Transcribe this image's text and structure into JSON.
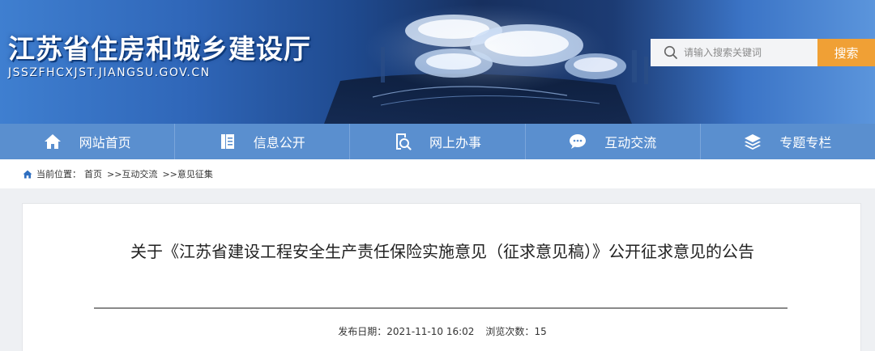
{
  "site": {
    "title": "江苏省住房和城乡建设厅",
    "domain": "JSSZFHCXJST.JIANGSU.GOV.CN"
  },
  "search": {
    "placeholder": "请输入搜索关键词",
    "button_label": "搜索"
  },
  "nav": {
    "items": [
      {
        "label": "网站首页",
        "icon": "home-icon"
      },
      {
        "label": "信息公开",
        "icon": "document-icon"
      },
      {
        "label": "网上办事",
        "icon": "search-document-icon"
      },
      {
        "label": "互动交流",
        "icon": "chat-bubble-icon"
      },
      {
        "label": "专题专栏",
        "icon": "layers-icon"
      }
    ]
  },
  "breadcrumb": {
    "prefix": "当前位置：",
    "items": [
      "首页",
      ">>互动交流",
      ">>意见征集"
    ]
  },
  "article": {
    "title": "关于《江苏省建设工程安全生产责任保险实施意见（征求意见稿）》公开征求意见的公告",
    "publish_label": "发布日期：",
    "publish_date": "2021-11-10 16:02",
    "views_label": "浏览次数：",
    "views": "15"
  },
  "colors": {
    "nav_bg": "#5a8fcf",
    "search_button": "#f0a035",
    "page_bg": "#eef0f3"
  }
}
